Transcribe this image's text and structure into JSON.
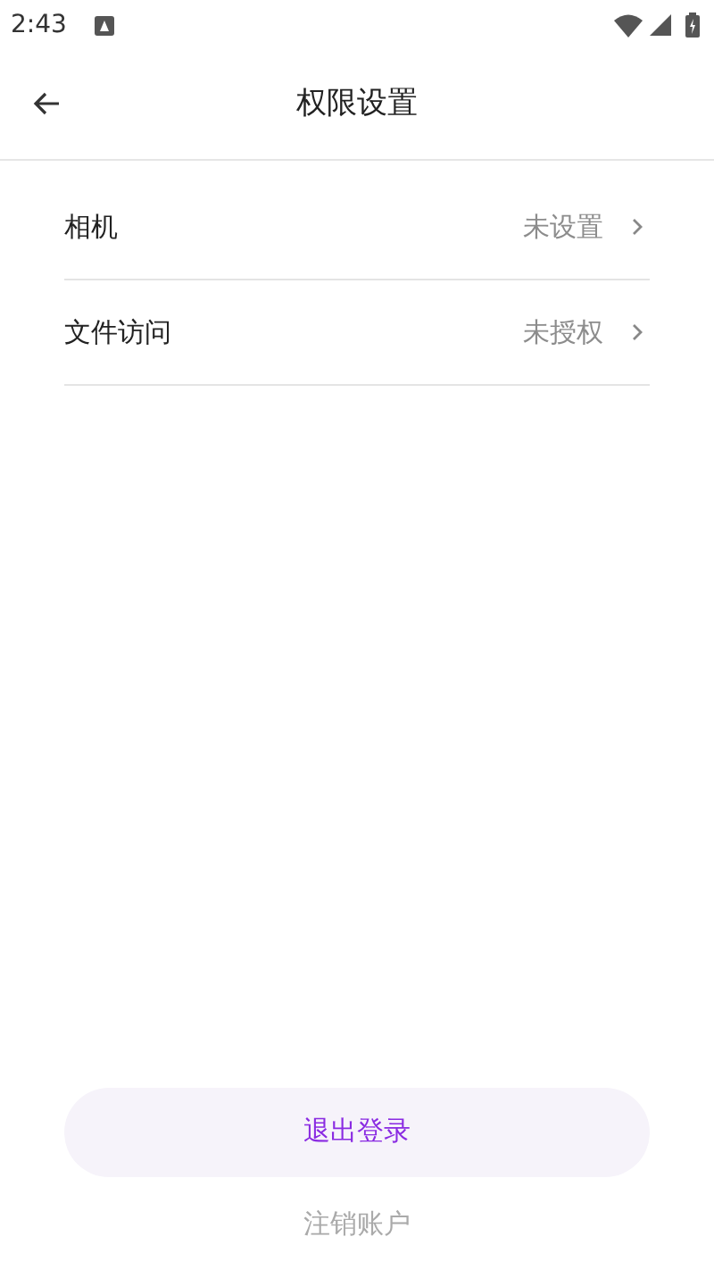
{
  "status_bar": {
    "time": "2:43"
  },
  "header": {
    "title": "权限设置"
  },
  "settings": [
    {
      "label": "相机",
      "value": "未设置"
    },
    {
      "label": "文件访问",
      "value": "未授权"
    }
  ],
  "logout_button": "退出登录",
  "delete_account_link": "注销账户"
}
